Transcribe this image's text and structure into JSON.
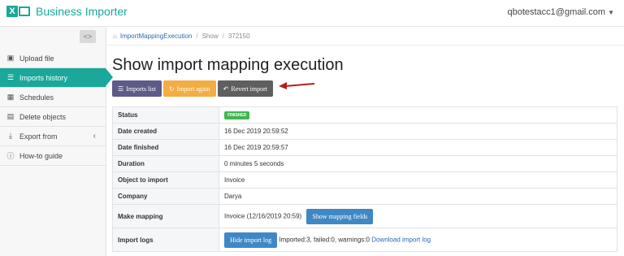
{
  "app": {
    "name": "Business Importer",
    "account": "qbotestacc1@gmail.com"
  },
  "sidebar": {
    "items": [
      {
        "label": "Upload file",
        "icon": "file-excel-icon"
      },
      {
        "label": "Imports history",
        "icon": "list-icon",
        "active": true
      },
      {
        "label": "Schedules",
        "icon": "calendar-icon"
      },
      {
        "label": "Delete objects",
        "icon": "trash-icon"
      },
      {
        "label": "Export from",
        "icon": "download-icon"
      },
      {
        "label": "How-to guide",
        "icon": "info-icon"
      }
    ]
  },
  "breadcrumb": {
    "item1": "ImportMappingExecution",
    "item2": "Show",
    "item3": "372150"
  },
  "page": {
    "title": "Show import mapping execution"
  },
  "toolbar": {
    "imports_list": "Imports list",
    "import_again": "Import again",
    "revert_import": "Revert import"
  },
  "details": {
    "status_label": "Status",
    "status_value": "FINISHED",
    "created_label": "Date created",
    "created_value": "16 Dec 2019 20:59:52",
    "finished_label": "Date finished",
    "finished_value": "16 Dec 2019 20:59:57",
    "duration_label": "Duration",
    "duration_value": "0 minutes 5 seconds",
    "object_label": "Object to import",
    "object_value": "Invoice",
    "company_label": "Company",
    "company_value": "Darya",
    "mapping_label": "Make mapping",
    "mapping_value": "Invoice (12/16/2019 20:59)",
    "mapping_button": "Show mapping fields",
    "logs_label": "Import logs",
    "logs_button": "Hide import log",
    "logs_summary": "Imported:3, failed:0, warnings:0",
    "logs_download": "Download import log"
  },
  "colors": {
    "brand": "#1aa89a",
    "status_finished": "#3fb64f",
    "arrow": "#b21f1f"
  }
}
